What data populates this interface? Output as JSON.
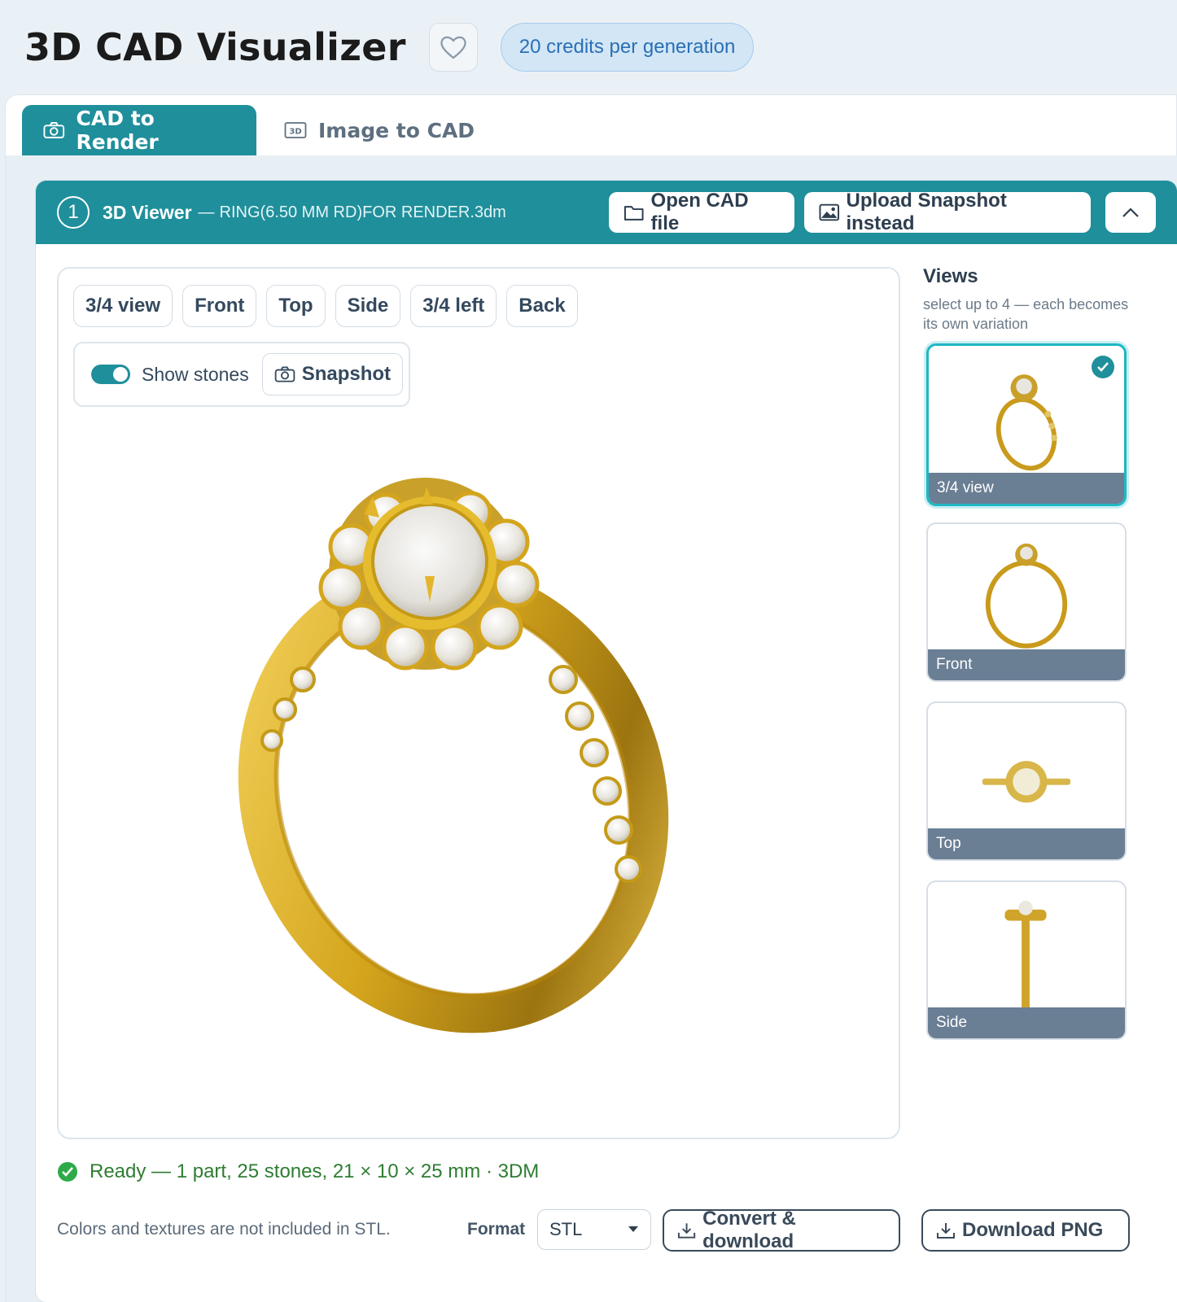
{
  "header": {
    "title": "3D CAD Visualizer",
    "credits": "20 credits per generation"
  },
  "tabs": [
    {
      "label": "CAD to Render",
      "icon": "camera-icon",
      "active": true
    },
    {
      "label": "Image to CAD",
      "icon": "3d-icon",
      "icon_text": "3D",
      "active": false
    }
  ],
  "viewer": {
    "step": "1",
    "title": "3D Viewer",
    "dash": "—",
    "filename": "RING(6.50 MM RD)FOR RENDER.3dm",
    "open_label": "Open CAD file",
    "upload_label": "Upload Snapshot instead",
    "view_buttons": [
      "3/4 view",
      "Front",
      "Top",
      "Side",
      "3/4 left",
      "Back"
    ],
    "show_stones_label": "Show stones",
    "show_stones_on": true,
    "snapshot_label": "Snapshot"
  },
  "views": {
    "title": "Views",
    "subtitle": "select up to 4 — each becomes its own variation",
    "items": [
      {
        "label": "3/4 view",
        "selected": true
      },
      {
        "label": "Front",
        "selected": false
      },
      {
        "label": "Top",
        "selected": false
      },
      {
        "label": "Side",
        "selected": false
      }
    ]
  },
  "footer": {
    "status": "Ready — 1 part, 25 stones, 21 × 10 × 25 mm · 3DM",
    "note": "Colors and textures are not included in STL.",
    "format_label": "Format",
    "format_value": "STL",
    "convert_label": "Convert & download",
    "png_label": "Download PNG"
  },
  "colors": {
    "accent": "#1f8f9b",
    "gold": "#d4a51c",
    "status_green": "#2e7d32"
  }
}
